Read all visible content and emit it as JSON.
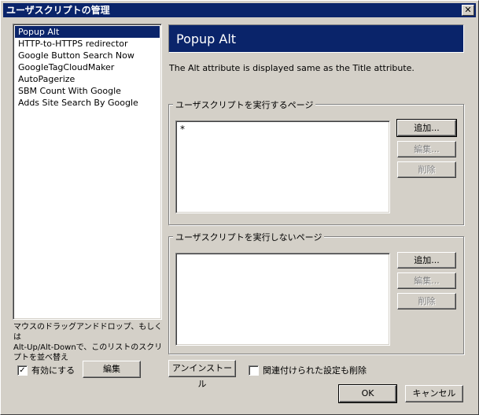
{
  "window": {
    "title": "ユーザスクリプトの管理",
    "close_glyph": "✕"
  },
  "scripts": {
    "items": [
      "Popup Alt",
      "HTTP-to-HTTPS redirector",
      "Google Button Search Now",
      "GoogleTagCloudMaker",
      "AutoPagerize",
      "SBM Count With Google",
      "Adds Site Search By Google"
    ],
    "selected_index": 0
  },
  "left_panel": {
    "hint_line1": "マウスのドラッグアンドドロップ、もしくは",
    "hint_line2": "Alt-Up/Alt-Downで、このリストのスクリ",
    "hint_line3": "プトを並べ替え",
    "enabled_label": "有効にする",
    "enabled_checked": true,
    "check_glyph": "✓",
    "edit_button": "編集"
  },
  "details": {
    "name": "Popup Alt",
    "description": "The Alt attribute is displayed same as the Title attribute.",
    "include_group": {
      "label": "ユーザスクリプトを実行するページ",
      "entries": "*",
      "add_button": "追加...",
      "edit_button": "編集...",
      "delete_button": "削除"
    },
    "exclude_group": {
      "label": "ユーザスクリプトを実行しないページ",
      "entries": "",
      "add_button": "追加...",
      "edit_button": "編集...",
      "delete_button": "削除"
    },
    "uninstall_button": "アンインストール",
    "delete_settings_label": "関連付けられた設定も削除",
    "delete_settings_checked": false
  },
  "footer": {
    "ok_button": "OK",
    "cancel_button": "キャンセル"
  },
  "colors": {
    "titlebar": "#0a246a",
    "face": "#d4d0c8",
    "disabled_text": "#808080"
  }
}
